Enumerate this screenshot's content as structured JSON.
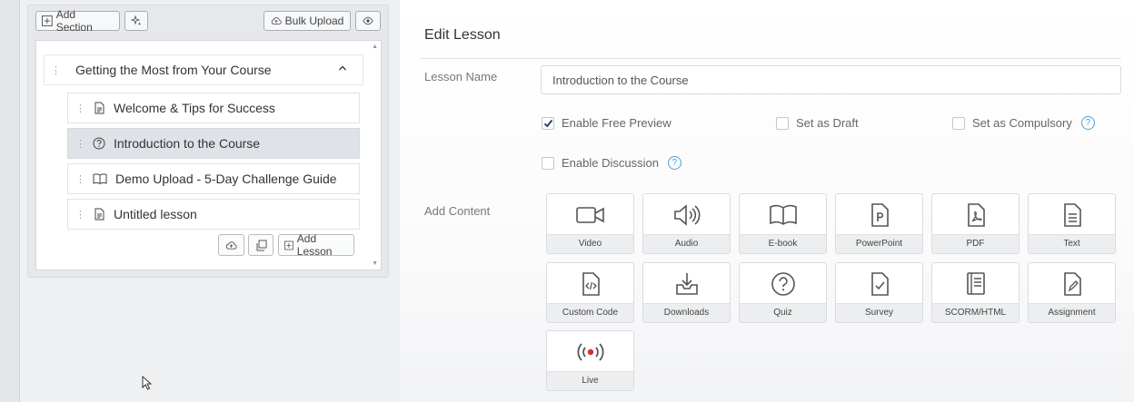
{
  "toolbar": {
    "add_section_label": "Add Section",
    "bulk_upload_label": "Bulk Upload"
  },
  "section": {
    "title": "Getting the Most from Your Course",
    "lessons": [
      {
        "title": "Welcome & Tips for Success",
        "icon": "document-icon"
      },
      {
        "title": "Introduction to the Course",
        "icon": "question-circle-icon",
        "active": true
      },
      {
        "title": "Demo Upload - 5-Day Challenge Guide",
        "icon": "book-icon"
      },
      {
        "title": "Untitled lesson",
        "icon": "document-icon"
      }
    ],
    "add_lesson_label": "Add Lesson"
  },
  "edit": {
    "title": "Edit Lesson",
    "lesson_name_label": "Lesson Name",
    "lesson_name_value": "Introduction to the Course",
    "options": {
      "free_preview": {
        "label": "Enable Free Preview",
        "checked": true
      },
      "draft": {
        "label": "Set as Draft",
        "checked": false
      },
      "compulsory": {
        "label": "Set as Compulsory",
        "checked": false
      },
      "discussion": {
        "label": "Enable Discussion",
        "checked": false
      }
    },
    "add_content_label": "Add Content",
    "content_types": [
      "Video",
      "Audio",
      "E-book",
      "PowerPoint",
      "PDF",
      "Text",
      "Custom Code",
      "Downloads",
      "Quiz",
      "Survey",
      "SCORM/HTML",
      "Assignment",
      "Live"
    ]
  },
  "colors": {
    "accent_blue": "#4a9fd8",
    "live_red": "#d32f2f",
    "active_row": "#dfe3e8"
  }
}
